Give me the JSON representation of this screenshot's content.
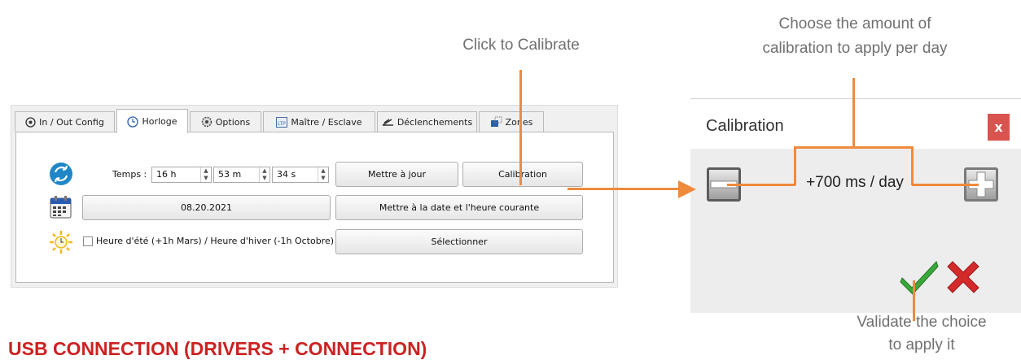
{
  "annotations": {
    "click_calibrate": "Click to Calibrate",
    "choose_amount_line1": "Choose the amount of",
    "choose_amount_line2": "calibration to apply per day",
    "validate_line1": "Validate the choice",
    "validate_line2": "to apply it"
  },
  "section_heading": "USB CONNECTION (DRIVERS + CONNECTION)",
  "tabs": [
    {
      "label": "In / Out Config",
      "icon": "gear-circle-icon"
    },
    {
      "label": "Horloge",
      "icon": "clock-icon"
    },
    {
      "label": "Options",
      "icon": "settings-icon"
    },
    {
      "label": "Maître / Esclave",
      "icon": "ltp-icon"
    },
    {
      "label": "Déclenchements",
      "icon": "trigger-icon"
    },
    {
      "label": "Zones",
      "icon": "zones-icon"
    }
  ],
  "clock": {
    "time_label": "Temps :",
    "hours": "16 h",
    "minutes": "53 m",
    "seconds": "34 s",
    "update_button": "Mettre à jour",
    "calibration_button": "Calibration",
    "date_value": "08.20.2021",
    "set_current_button": "Mettre à la date et l'heure courante",
    "dst_label": "Heure d'été (+1h Mars) / Heure d'hiver (-1h Octobre)",
    "select_button": "Sélectionner"
  },
  "dialog": {
    "title": "Calibration",
    "close_label": "x",
    "value": "+700 ms / day"
  },
  "colors": {
    "accent_orange": "#f08a3c",
    "heading_red": "#cc2222",
    "close_red": "#d9534f",
    "check_green": "#3aa83a",
    "cross_red": "#d42a2a"
  }
}
